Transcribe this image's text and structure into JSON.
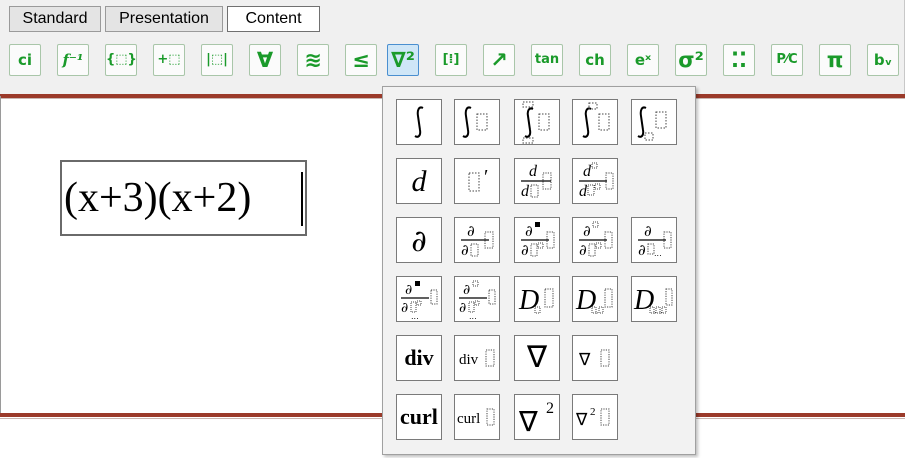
{
  "tabs": [
    {
      "label": "Standard",
      "active": false
    },
    {
      "label": "Presentation",
      "active": false
    },
    {
      "label": "Content",
      "active": true
    }
  ],
  "toolbar": [
    {
      "label": "ci",
      "icon": "ci-icon"
    },
    {
      "label": "f⁻¹",
      "icon": "inverse-function-icon"
    },
    {
      "label": "{⬚}",
      "icon": "set-icon"
    },
    {
      "label": "+⬚",
      "icon": "arithmetic-icon"
    },
    {
      "label": "|⬚|",
      "icon": "absolute-value-icon"
    },
    {
      "label": "∀",
      "icon": "for-all-icon"
    },
    {
      "label": "≋",
      "icon": "relations-icon"
    },
    {
      "label": "≤",
      "icon": "less-equal-icon"
    },
    {
      "label": "∇²",
      "icon": "calculus-icon",
      "active": true
    },
    {
      "label": "[⁞]",
      "icon": "matrix-icon"
    },
    {
      "label": "↗",
      "icon": "vector-icon"
    },
    {
      "label": "tan",
      "icon": "trig-icon"
    },
    {
      "label": "ch",
      "icon": "hyperbolic-icon"
    },
    {
      "label": "eˣ",
      "icon": "exponential-icon"
    },
    {
      "label": "σ²",
      "icon": "statistics-icon"
    },
    {
      "label": "⁚⁚",
      "icon": "grid-icon"
    },
    {
      "label": "P⁄C",
      "icon": "combinatorics-icon"
    },
    {
      "label": "π",
      "icon": "pi-icon"
    },
    {
      "label": "bᵥ",
      "icon": "bound-variable-icon"
    }
  ],
  "expression": "(x+3)(x+2)",
  "palette": {
    "row1": [
      "integral",
      "integral-box",
      "integral-bounds-box",
      "integral-lower-box",
      "integral-interval-box"
    ],
    "row2": [
      "d",
      "prime",
      "d-by-d",
      "d2-by-d"
    ],
    "row3": [
      "partial",
      "partial-fraction",
      "partial-fraction-n",
      "partial-fraction-2",
      "partial-fraction-multi"
    ],
    "row4": [
      "partial-mixed-a",
      "partial-mixed-b",
      "D-sub",
      "D-sub-2",
      "D-sub-3"
    ],
    "row5_labels": [
      "div",
      "div",
      "∇",
      "∇"
    ],
    "row6_labels": [
      "curl",
      "curl",
      "∇",
      "∇"
    ],
    "sup2": "2"
  }
}
